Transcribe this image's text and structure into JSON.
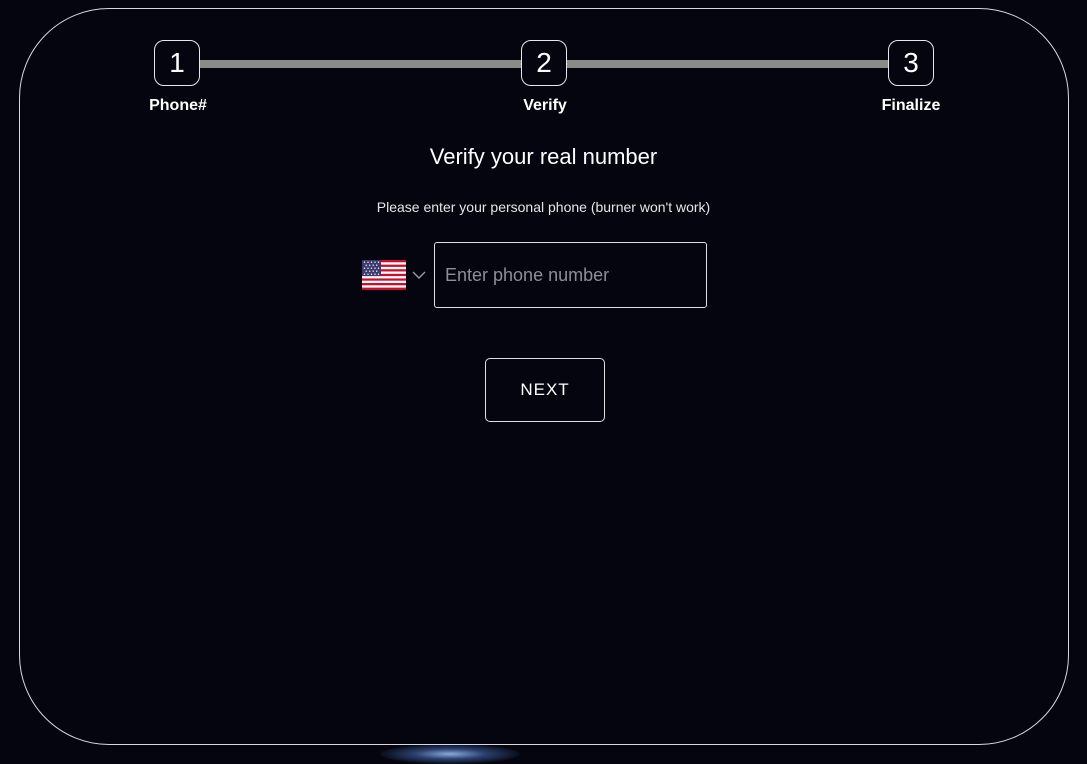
{
  "stepper": {
    "steps": [
      {
        "number": "1",
        "label": "Phone#"
      },
      {
        "number": "2",
        "label": "Verify"
      },
      {
        "number": "3",
        "label": "Finalize"
      }
    ]
  },
  "form": {
    "title": "Verify your real number",
    "subtitle": "Please enter your personal phone (burner won't work)",
    "country": {
      "flag_icon": "us-flag-icon"
    },
    "phone_placeholder": "Enter phone number",
    "phone_value": "",
    "next_label": "NEXT"
  },
  "colors": {
    "background": "#050510",
    "border": "#d9d9dd",
    "track": "#8a8a8a",
    "placeholder": "#8e8e94"
  }
}
